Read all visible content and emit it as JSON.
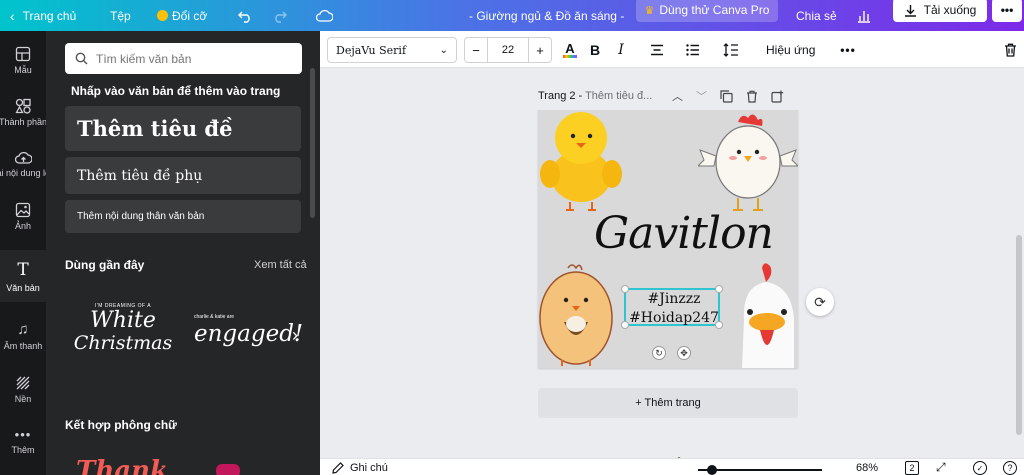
{
  "topbar": {
    "home": "Trang chủ",
    "file": "Tệp",
    "resize": "Đổi cỡ",
    "doc_title": "- Giường ngủ & Đồ ăn sáng -",
    "try_pro": "Dùng thử Canva Pro",
    "share": "Chia sẻ",
    "download": "Tải xuống",
    "gradient": [
      "#00c4cc",
      "#7d2ae8"
    ]
  },
  "rail": {
    "items": [
      {
        "label": "Mẫu",
        "icon": "template-icon"
      },
      {
        "label": "Thành phần",
        "icon": "elements-icon"
      },
      {
        "label": "Tải nội dung lên",
        "icon": "upload-icon"
      },
      {
        "label": "Ảnh",
        "icon": "photo-icon"
      },
      {
        "label": "Văn bản",
        "icon": "text-icon"
      },
      {
        "label": "Âm thanh",
        "icon": "music-icon"
      },
      {
        "label": "Nền",
        "icon": "background-icon"
      },
      {
        "label": "Thêm",
        "icon": "more-icon"
      }
    ]
  },
  "panel": {
    "search_placeholder": "Tìm kiếm văn bản",
    "hint": "Nhấp vào văn bản để thêm vào trang",
    "add_heading": "Thêm tiêu đề",
    "add_subheading": "Thêm tiêu đề phụ",
    "add_body": "Thêm nội dung thân văn bản",
    "recent_title": "Dùng gần đây",
    "see_all": "Xem tất cả",
    "recent_1_small": "I'M DREAMING OF A",
    "recent_1_line1": "White",
    "recent_1_line2": "Christmas",
    "recent_2_small": "charlie & katie are",
    "recent_2_main": "engaged!",
    "combos_title": "Kết hợp phông chữ",
    "combo_preview": "Thank"
  },
  "toolbar": {
    "font": "DejaVu Serif",
    "size": "22",
    "effects": "Hiệu ứng"
  },
  "canvas": {
    "page_label": "Trang 2 - ",
    "page_sub": "Thêm tiêu đ...",
    "title_text": "Gavitlon",
    "selected_line1": "#Jinzzz",
    "selected_line2": "#Hoidap247",
    "add_page": "+ Thêm trang",
    "page_bg": "#d9d9d9",
    "selection_color": "#2ec5d3"
  },
  "bottom": {
    "notes": "Ghi chú",
    "zoom": "68%",
    "page_count": "2"
  }
}
